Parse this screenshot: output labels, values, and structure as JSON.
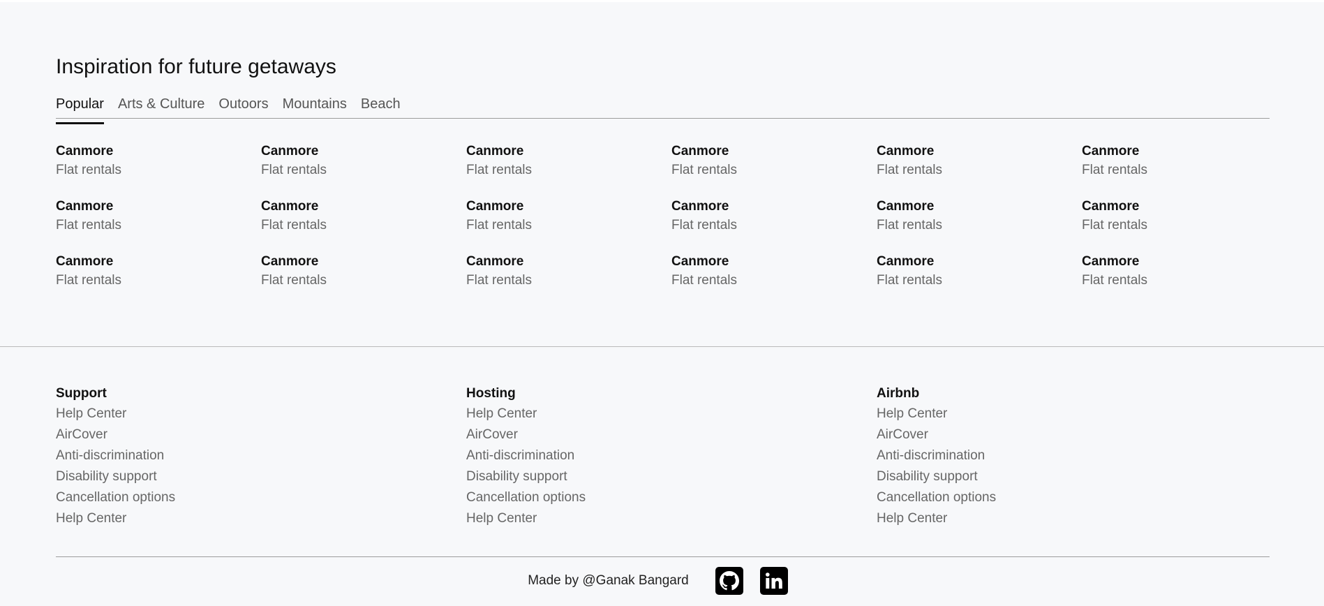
{
  "inspiration": {
    "title": "Inspiration for future getaways",
    "tabs": [
      "Popular",
      "Arts & Culture",
      "Outoors",
      "Mountains",
      "Beach"
    ],
    "active_tab": "Popular",
    "destinations": [
      {
        "name": "Canmore",
        "sub": "Flat rentals"
      },
      {
        "name": "Canmore",
        "sub": "Flat rentals"
      },
      {
        "name": "Canmore",
        "sub": "Flat rentals"
      },
      {
        "name": "Canmore",
        "sub": "Flat rentals"
      },
      {
        "name": "Canmore",
        "sub": "Flat rentals"
      },
      {
        "name": "Canmore",
        "sub": "Flat rentals"
      },
      {
        "name": "Canmore",
        "sub": "Flat rentals"
      },
      {
        "name": "Canmore",
        "sub": "Flat rentals"
      },
      {
        "name": "Canmore",
        "sub": "Flat rentals"
      },
      {
        "name": "Canmore",
        "sub": "Flat rentals"
      },
      {
        "name": "Canmore",
        "sub": "Flat rentals"
      },
      {
        "name": "Canmore",
        "sub": "Flat rentals"
      },
      {
        "name": "Canmore",
        "sub": "Flat rentals"
      },
      {
        "name": "Canmore",
        "sub": "Flat rentals"
      },
      {
        "name": "Canmore",
        "sub": "Flat rentals"
      },
      {
        "name": "Canmore",
        "sub": "Flat rentals"
      },
      {
        "name": "Canmore",
        "sub": "Flat rentals"
      },
      {
        "name": "Canmore",
        "sub": "Flat rentals"
      }
    ]
  },
  "footer": {
    "columns": [
      {
        "title": "Support",
        "links": [
          "Help Center",
          "AirCover",
          "Anti-discrimination",
          "Disability support",
          "Cancellation options",
          "Help Center"
        ]
      },
      {
        "title": "Hosting",
        "links": [
          "Help Center",
          "AirCover",
          "Anti-discrimination",
          "Disability support",
          "Cancellation options",
          "Help Center"
        ]
      },
      {
        "title": "Airbnb",
        "links": [
          "Help Center",
          "AirCover",
          "Anti-discrimination",
          "Disability support",
          "Cancellation options",
          "Help Center"
        ]
      }
    ],
    "credit": "Made by @Ganak Bangard",
    "social_icons": [
      "github-icon",
      "linkedin-icon"
    ]
  },
  "colors": {
    "background": "#f7f8fa",
    "text": "#111111",
    "muted_text": "#666666",
    "icon_bg": "#000000"
  }
}
